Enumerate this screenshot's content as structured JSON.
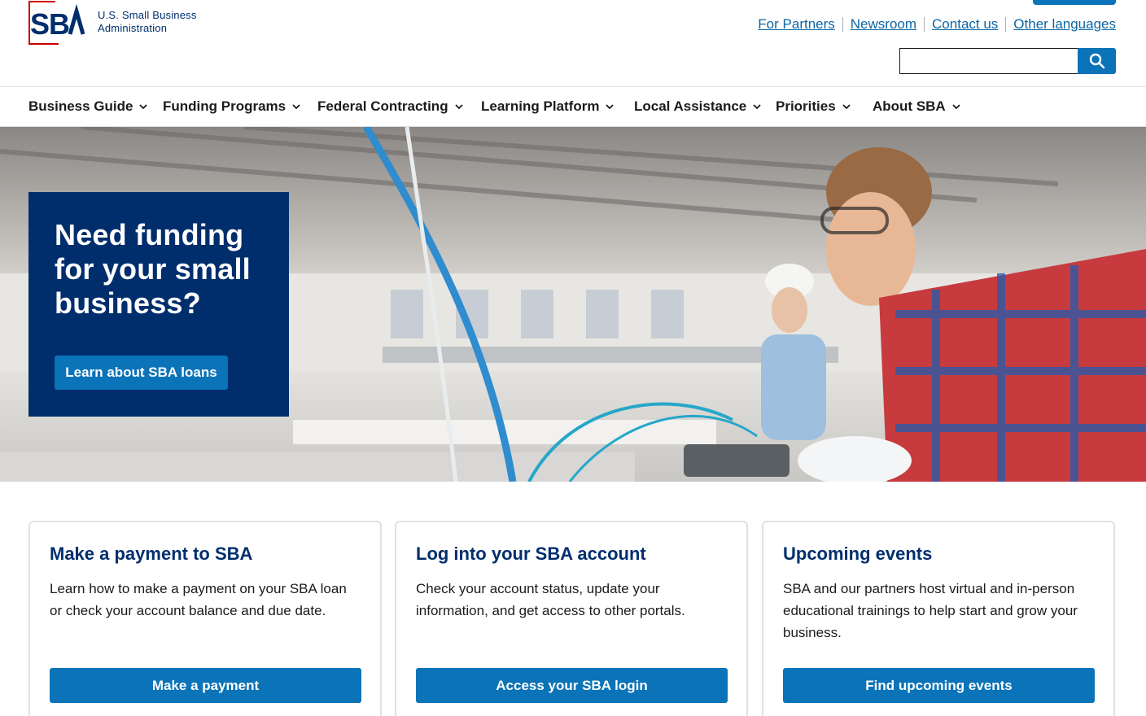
{
  "header": {
    "org_line1": "U.S. Small Business",
    "org_line2": "Administration",
    "logo_letters": "SBA",
    "util_links": [
      "For Partners",
      "Newsroom",
      "Contact us",
      "Other languages"
    ],
    "search": {
      "value": "",
      "placeholder": "",
      "button_icon": "search-icon"
    }
  },
  "nav": {
    "items": [
      "Business Guide",
      "Funding Programs",
      "Federal Contracting",
      "Learning Platform",
      "Local Assistance",
      "Priorities",
      "About SBA"
    ],
    "icon": "chevron-down-icon"
  },
  "hero": {
    "title": "Need funding for your small business?",
    "button_label": "Learn about SBA loans"
  },
  "cards": [
    {
      "title": "Make a payment to SBA",
      "text": "Learn how to make a payment on your SBA loan or check your account balance and due date.",
      "button_label": "Make a payment"
    },
    {
      "title": "Log into your SBA account",
      "text": "Check your account status, update your information, and get access to other portals.",
      "button_label": "Access your SBA login"
    },
    {
      "title": "Upcoming events",
      "text": "SBA and our partners host virtual and in-person educational trainings to help start and grow your business.",
      "button_label": "Find upcoming events"
    }
  ],
  "colors": {
    "brand_navy": "#002e6d",
    "brand_blue": "#0b73b8",
    "brand_red": "#cc0000",
    "link_blue": "#0b66a3"
  }
}
